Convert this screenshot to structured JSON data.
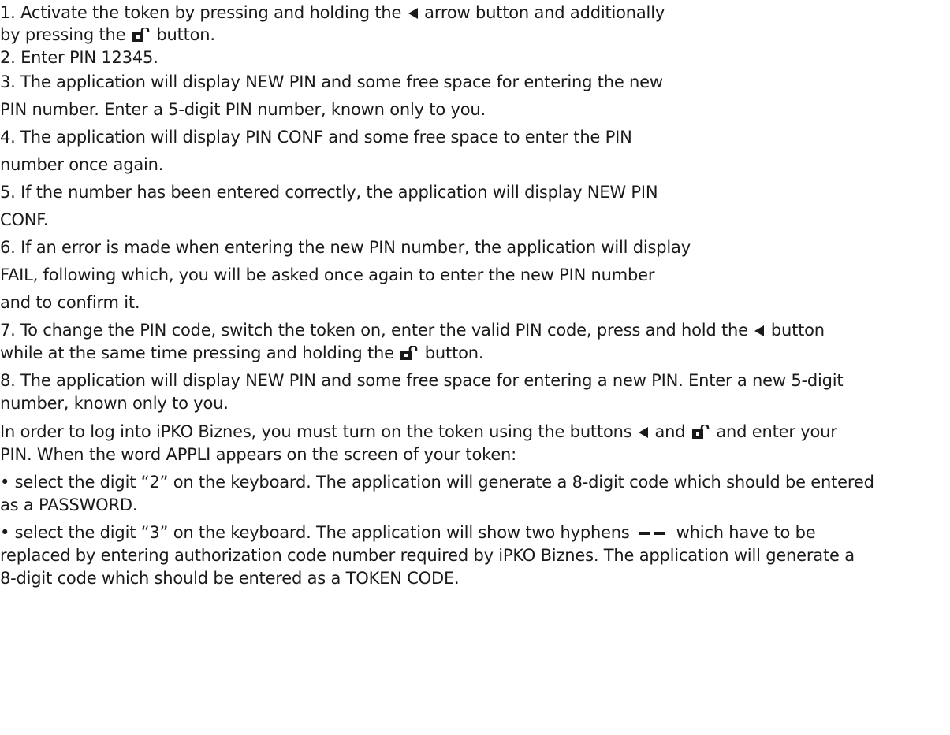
{
  "lines": {
    "l1_a": "1. Activate the token by pressing and holding the",
    "l1_b": "arrow button and additionally",
    "l2_a": "by pressing the",
    "l2_b": "button.",
    "l3": "2. Enter PIN 12345.",
    "l4": "3. The application will display NEW PIN and some free space for entering the new",
    "l5": "PIN number. Enter a 5-digit PIN number, known only to you.",
    "l6": "4. The application will display PIN CONF and some free space to enter the PIN",
    "l7": "number once again.",
    "l8": "5. If the number has been entered correctly, the application will display NEW PIN",
    "l9": "CONF.",
    "l10": "6. If an error is made when entering the new PIN number, the application will display",
    "l11": "FAIL, following which, you will be asked once again to enter the new PIN number",
    "l12": "and to confirm it.",
    "l13_a": "7. To change the PIN code, switch the token on, enter the valid PIN code, press and hold the",
    "l13_b": "button",
    "l14_a": "while at the same time pressing and holding the",
    "l14_b": "button.",
    "l15": "8. The application will display NEW PIN and some free space for entering a new PIN. Enter a new 5-digit",
    "l16": "number, known only to you.",
    "l17_a": "In order to log into iPKO Biznes, you must turn on the token using the buttons",
    "l17_b": "and",
    "l17_c": "and enter your",
    "l18": "PIN. When the word APPLI appears on the screen of your token:",
    "l19": "• select the digit “2” on the keyboard. The application will generate a 8-digit code which should be entered",
    "l20": "as a PASSWORD.",
    "l21_a": "•  select the digit “3” on the keyboard. The application will show two hyphens",
    "l21_b": "which have to be",
    "l22": "replaced by entering authorization code number required by iPKO Biznes. The application will generate a",
    "l23": "8-digit code which should be entered as a TOKEN CODE."
  },
  "icons": {
    "arrow": "left-arrow-icon",
    "lock": "unlock-icon",
    "hyphens": "double-hyphen-icon"
  },
  "colors": {
    "text": "#1a1a1a",
    "background": "#ffffff"
  }
}
